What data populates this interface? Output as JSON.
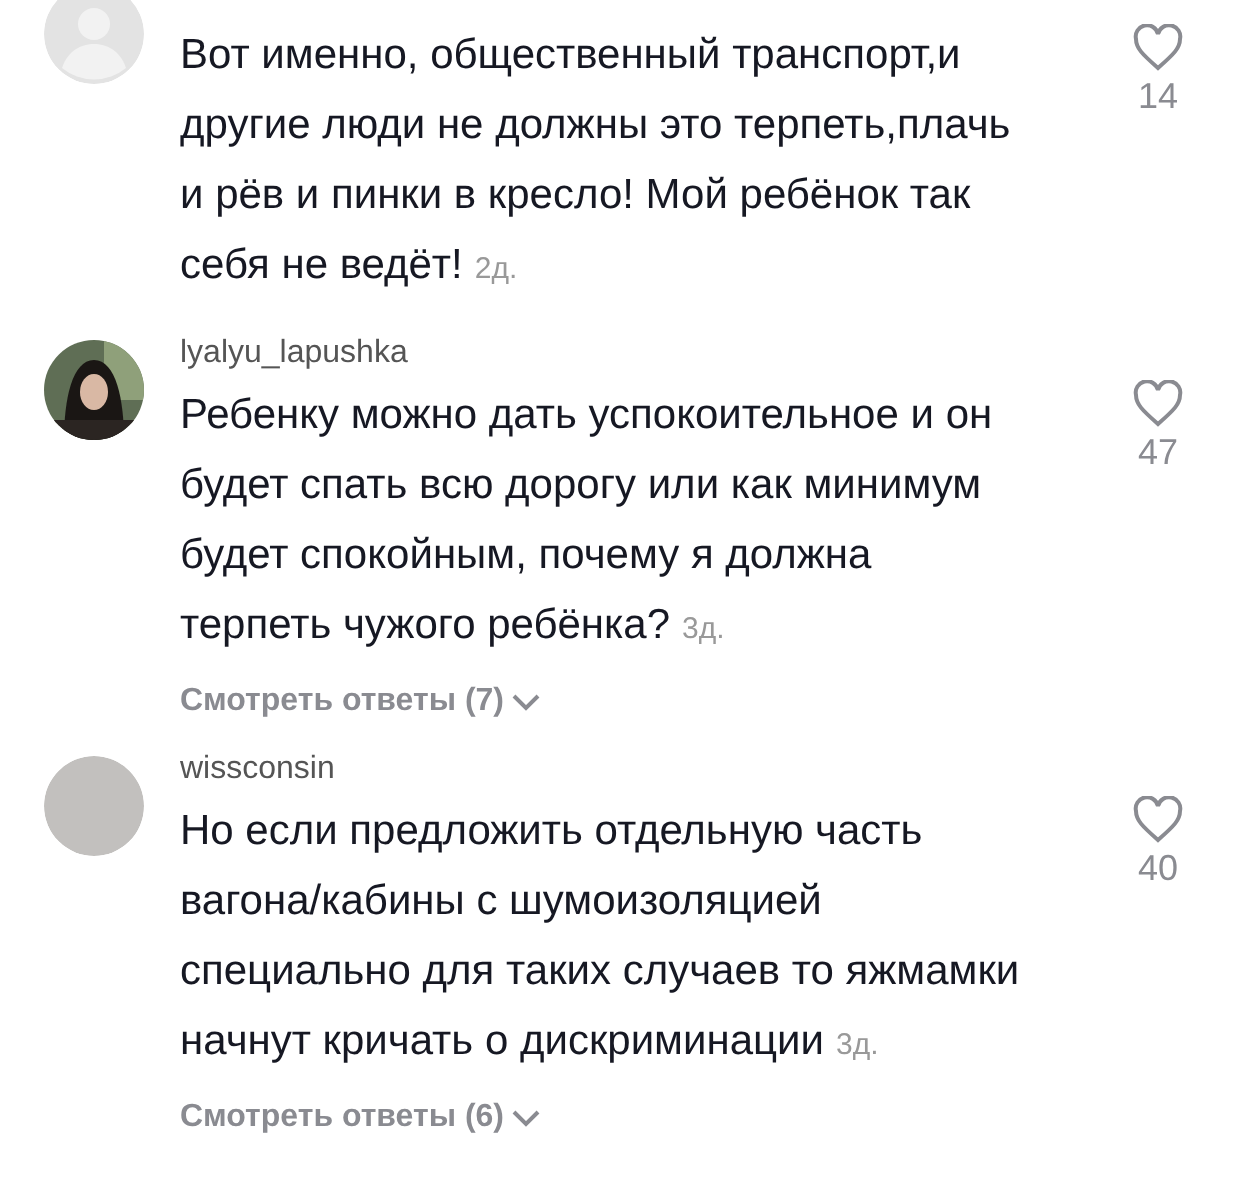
{
  "comments": [
    {
      "avatar": {
        "kind": "default"
      },
      "text": "Вот именно, общественный транспорт,и другие люди не должны это терпеть,плачь и рёв и пинки в кресло! Мой ребёнок так себя не ведёт!",
      "time": "2д.",
      "likes": "14"
    },
    {
      "username": "lyalyu_lapushka",
      "text": "Ребенку можно дать успокоительное и он будет спать всю дорогу или как минимум будет спокойным, почему я должна терпеть чужого ребёнка?",
      "time": "3д.",
      "likes": "47",
      "replies": "Смотреть ответы (7)"
    },
    {
      "avatar": {
        "kind": "plain"
      },
      "username": "wissconsin",
      "text": "Но если предложить отдельную часть вагона/кабины с шумоизоляцией специально для таких случаев то яжмамки начнут кричать о дискриминации",
      "time": "3д.",
      "likes": "40",
      "replies": "Смотреть ответы (6)"
    }
  ]
}
